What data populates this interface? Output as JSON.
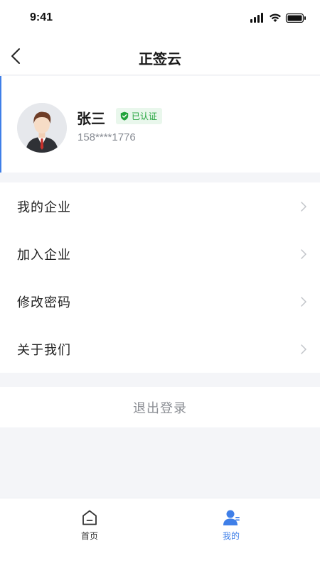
{
  "status_bar": {
    "time": "9:41"
  },
  "nav": {
    "title": "正签云"
  },
  "profile": {
    "name": "张三",
    "verified_badge": "已认证",
    "phone": "158****1776"
  },
  "menu": {
    "items": [
      {
        "label": "我的企业"
      },
      {
        "label": "加入企业"
      },
      {
        "label": "修改密码"
      },
      {
        "label": "关于我们"
      }
    ]
  },
  "logout": {
    "label": "退出登录"
  },
  "tab_bar": {
    "tabs": [
      {
        "label": "首页",
        "icon": "home-icon",
        "active": false
      },
      {
        "label": "我的",
        "icon": "user-icon",
        "active": true
      }
    ]
  },
  "colors": {
    "accent": "#3f7fe8",
    "verified_green": "#21a33b",
    "background": "#f4f5f8"
  }
}
